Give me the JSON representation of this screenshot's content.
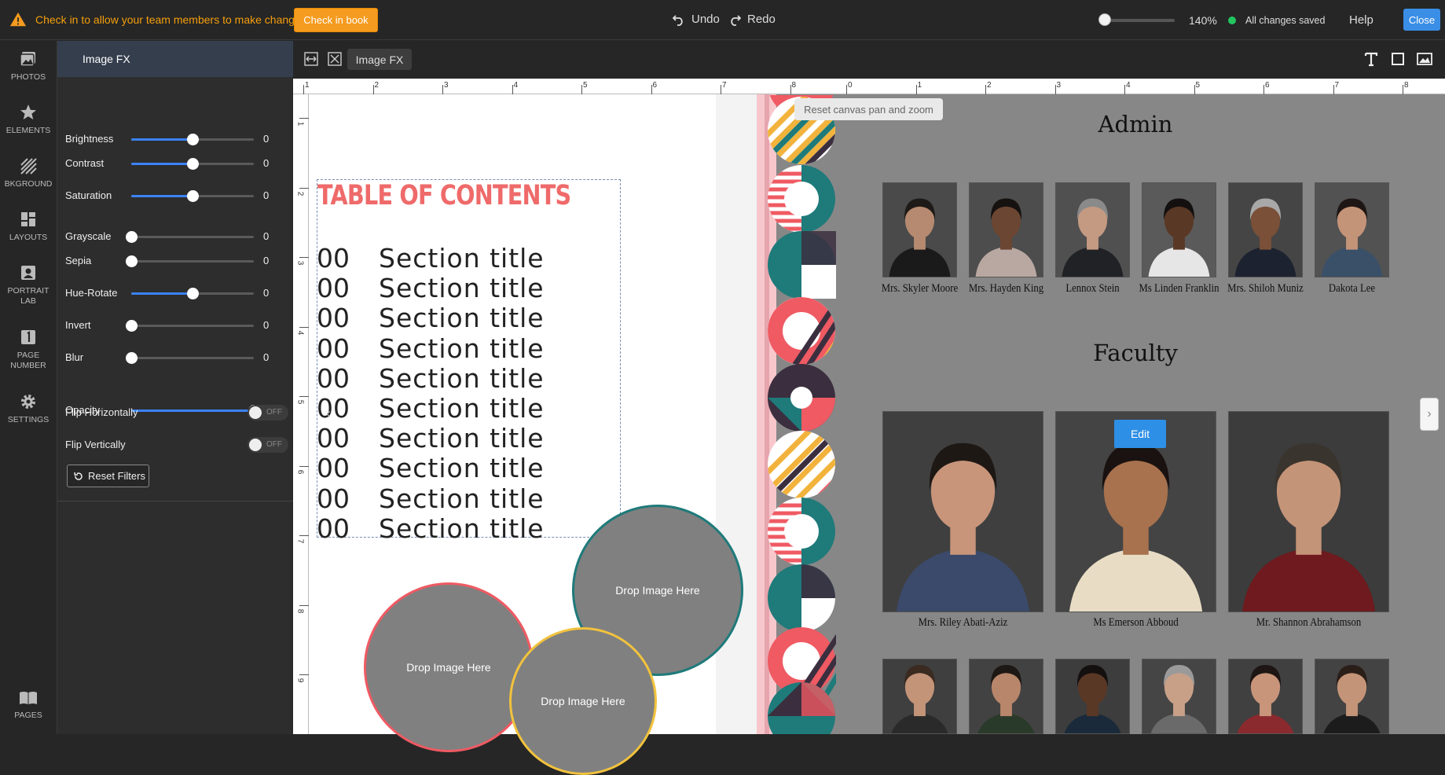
{
  "topbar": {
    "warning_text": "Check in to allow your team members to make changes",
    "checkin_label": "Check in book",
    "undo_label": "Undo",
    "redo_label": "Redo",
    "zoom_value": "140%",
    "zoom_level_fraction": 0.05,
    "saved_text": "All changes saved",
    "help_label": "Help",
    "close_label": "Close",
    "accent_color": "#f59b1f",
    "primary_color": "#3a8ee6"
  },
  "leftnav": {
    "items": [
      {
        "label": "PHOTOS",
        "icon": "photos-icon"
      },
      {
        "label": "ELEMENTS",
        "icon": "star-icon"
      },
      {
        "label": "BKGROUND",
        "icon": "background-icon"
      },
      {
        "label": "LAYOUTS",
        "icon": "layouts-icon"
      },
      {
        "label": "PORTRAIT LAB",
        "icon": "portrait-icon"
      },
      {
        "label": "PAGE NUMBER",
        "icon": "page-number-icon"
      },
      {
        "label": "SETTINGS",
        "icon": "gear-icon"
      },
      {
        "label": "PAGES",
        "icon": "book-icon"
      }
    ]
  },
  "panel": {
    "title": "Image FX",
    "filters": [
      {
        "label": "Brightness",
        "value": "0",
        "level": 0.5
      },
      {
        "label": "Contrast",
        "value": "0",
        "level": 0.5
      },
      {
        "label": "Saturation",
        "value": "0",
        "level": 0.5
      },
      {
        "label": "Grayscale",
        "value": "0",
        "level": 0.0
      },
      {
        "label": "Sepia",
        "value": "0",
        "level": 0.0
      },
      {
        "label": "Hue-Rotate",
        "value": "0",
        "level": 0.5
      },
      {
        "label": "Invert",
        "value": "0",
        "level": 0.0
      },
      {
        "label": "Blur",
        "value": "0",
        "level": 0.0
      },
      {
        "label": "Opacity",
        "value": "100",
        "level": 1.0
      }
    ],
    "flip_h_label": "Flip Horizontally",
    "flip_v_label": "Flip Vertically",
    "toggle_off": "OFF",
    "reset_label": "Reset Filters"
  },
  "toolbar": {
    "imagefx_label": "Image FX"
  },
  "canvas": {
    "reset_tip": "Reset canvas pan and zoom",
    "ruler_left": [
      "1",
      "2",
      "3",
      "4",
      "5",
      "6",
      "7",
      "8"
    ],
    "ruler_right": [
      "0",
      "1",
      "2",
      "3",
      "4",
      "5",
      "6",
      "7",
      "8"
    ],
    "ruler_vertical": [
      "1",
      "2",
      "3",
      "4",
      "5",
      "6",
      "7",
      "8",
      "9"
    ],
    "toc": {
      "title": "TABLE OF CONTENTS",
      "rows": [
        {
          "num": "00",
          "title": "Section title"
        },
        {
          "num": "00",
          "title": "Section title"
        },
        {
          "num": "00",
          "title": "Section title"
        },
        {
          "num": "00",
          "title": "Section title"
        },
        {
          "num": "00",
          "title": "Section title"
        },
        {
          "num": "00",
          "title": "Section title"
        },
        {
          "num": "00",
          "title": "Section title"
        },
        {
          "num": "00",
          "title": "Section title"
        },
        {
          "num": "00",
          "title": "Section title"
        },
        {
          "num": "00",
          "title": "Section title"
        }
      ]
    },
    "drop_label": "Drop Image Here",
    "admin_title": "Admin",
    "faculty_title": "Faculty",
    "admin": [
      {
        "name": "Mrs. Skyler Moore"
      },
      {
        "name": "Mrs. Hayden King"
      },
      {
        "name": "Lennox Stein"
      },
      {
        "name": "Ms Linden Franklin"
      },
      {
        "name": "Mrs. Shiloh Muniz"
      },
      {
        "name": "Dakota Lee"
      }
    ],
    "faculty": [
      {
        "name": "Mrs. Riley Abati-Aziz"
      },
      {
        "name": "Ms Emerson Abboud"
      },
      {
        "name": "Mr. Shannon Abrahamson"
      }
    ],
    "edit_label": "Edit"
  }
}
